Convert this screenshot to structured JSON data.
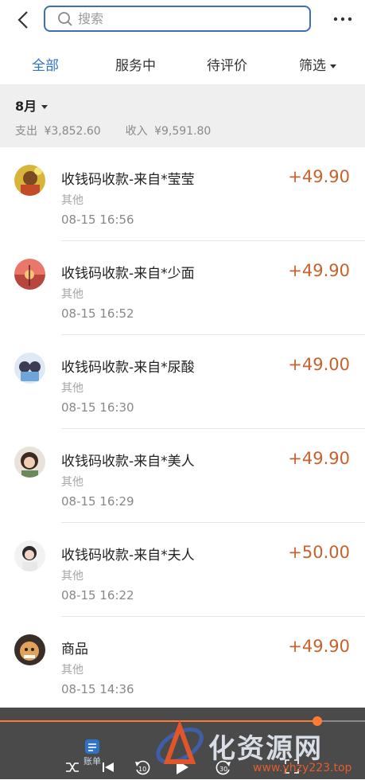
{
  "search": {
    "placeholder": "搜索"
  },
  "tabs": [
    {
      "label": "全部",
      "active": true
    },
    {
      "label": "服务中",
      "active": false
    },
    {
      "label": "待评价",
      "active": false
    },
    {
      "label": "筛选",
      "active": false
    }
  ],
  "month": {
    "label": "8月",
    "expense_label": "支出",
    "expense_value": "¥3,852.60",
    "income_label": "收入",
    "income_value": "¥9,591.80"
  },
  "transactions": [
    {
      "title": "收钱码收款-来自*莹莹",
      "category": "其他",
      "time": "08-15 16:56",
      "amount": "+49.90"
    },
    {
      "title": "收钱码收款-来自*少面",
      "category": "其他",
      "time": "08-15 16:52",
      "amount": "+49.90"
    },
    {
      "title": "收钱码收款-来自*尿酸",
      "category": "其他",
      "time": "08-15 16:30",
      "amount": "+49.00"
    },
    {
      "title": "收钱码收款-来自*美人",
      "category": "其他",
      "time": "08-15 16:29",
      "amount": "+49.90"
    },
    {
      "title": "收钱码收款-来自*夫人",
      "category": "其他",
      "time": "08-15 16:22",
      "amount": "+50.00"
    },
    {
      "title": "商品",
      "category": "其他",
      "time": "08-15 14:36",
      "amount": "+49.90"
    }
  ],
  "bottom": {
    "bill_tab_label": "账单",
    "video_progress": 0.87,
    "rewind_label": "10",
    "forward_label": "30"
  },
  "watermark": {
    "text": "化资源网",
    "url": "www.yhzy223.top"
  },
  "colors": {
    "accent": "#2f73c9",
    "income": "#c8612c",
    "progress": "#ff7a33"
  }
}
